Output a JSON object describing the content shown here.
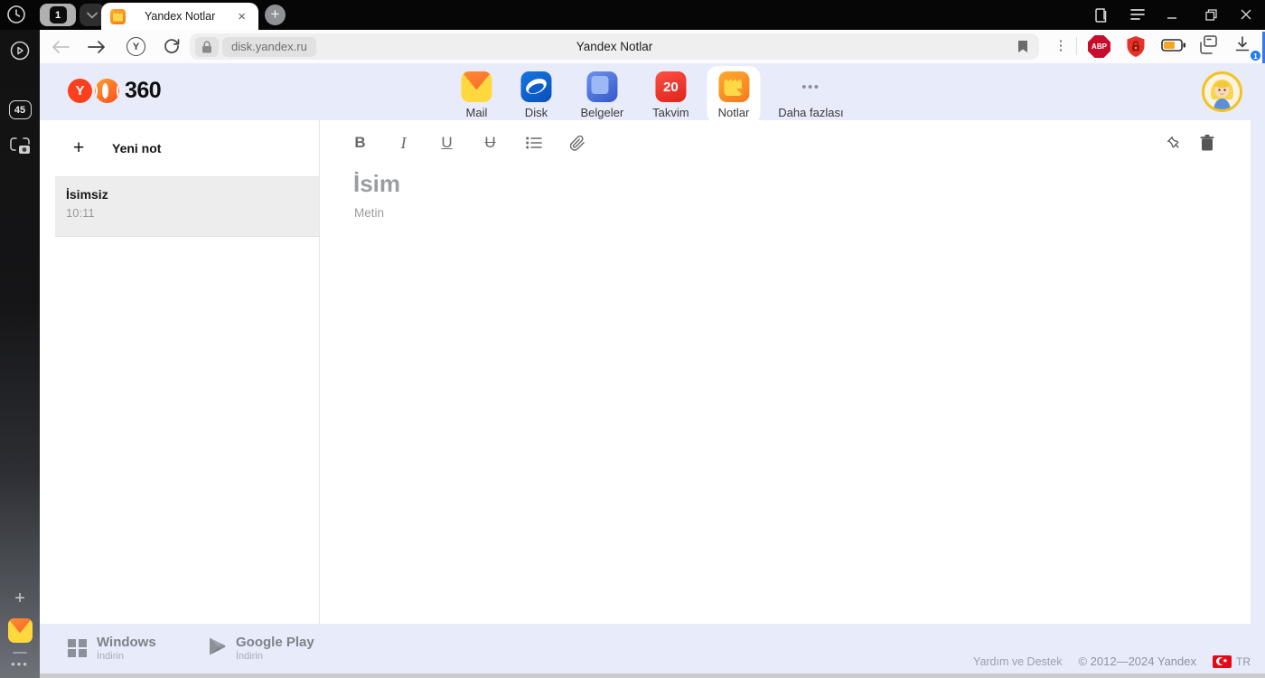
{
  "window": {
    "tab_counter": "1",
    "tab_title": "Yandex Notlar",
    "page_title": "Yandex Notlar",
    "url": "disk.yandex.ru",
    "abp_label": "ABP",
    "downloads_badge": "1"
  },
  "siderail": {
    "history_badge": "45"
  },
  "header": {
    "logo_text": "360",
    "nav": [
      {
        "label": "Mail"
      },
      {
        "label": "Disk"
      },
      {
        "label": "Belgeler"
      },
      {
        "label": "Takvim",
        "badge": "20"
      },
      {
        "label": "Notlar",
        "active": true
      },
      {
        "label": "Daha fazlası"
      }
    ]
  },
  "notes_panel": {
    "new_note_label": "Yeni not",
    "notes": [
      {
        "title": "İsimsiz",
        "time": "10:11"
      }
    ]
  },
  "editor": {
    "toolbar": {
      "bold": "B",
      "italic": "I",
      "underline": "U",
      "strike": "U"
    },
    "title_placeholder": "İsim",
    "body_placeholder": "Metin"
  },
  "footer": {
    "apps": [
      {
        "name": "Windows",
        "action": "İndirin"
      },
      {
        "name": "Google Play",
        "action": "İndirin"
      }
    ],
    "help": "Yardım ve Destek",
    "copyright": "© 2012—2024 Yandex",
    "region": "TR"
  },
  "colors": {
    "accent_blue": "#3a76e8",
    "header_bg": "#e8ecfa",
    "abp_red": "#c70d2c",
    "takvim_red": "#e22b22",
    "notes_orange": "#f5781f",
    "battery_fill": "#f5a623"
  }
}
